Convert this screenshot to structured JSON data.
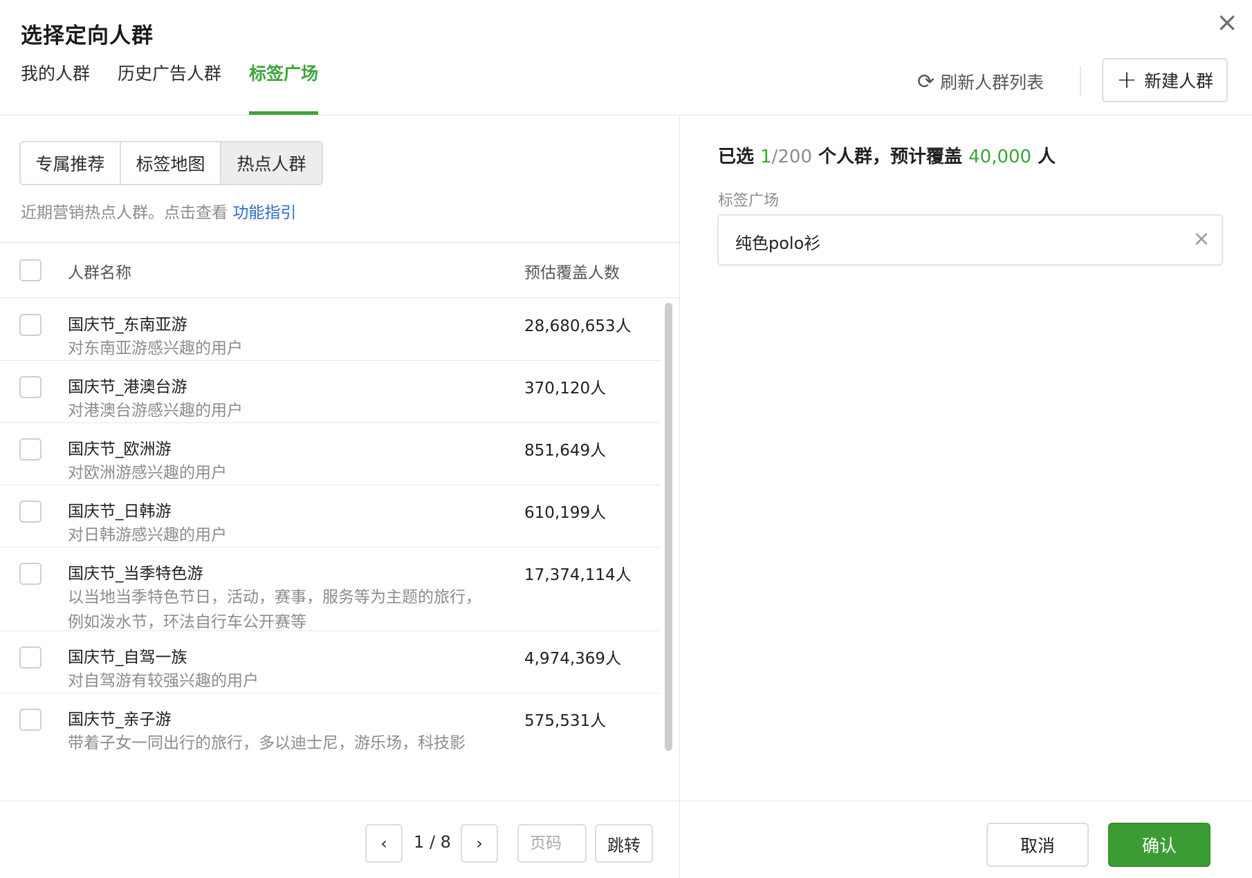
{
  "dialog": {
    "title": "选择定向人群",
    "close_icon": "×"
  },
  "tabs": [
    {
      "label": "我的人群",
      "active": false
    },
    {
      "label": "历史广告人群",
      "active": false
    },
    {
      "label": "标签广场",
      "active": true
    }
  ],
  "toolbar": {
    "refresh_icon": "⟳",
    "refresh_label": "刷新人群列表",
    "new_icon": "+",
    "new_label": "新建人群"
  },
  "segments": [
    {
      "label": "专属推荐",
      "active": false
    },
    {
      "label": "标签地图",
      "active": false
    },
    {
      "label": "热点人群",
      "active": true
    }
  ],
  "hint": {
    "text": "近期营销热点人群。点击查看 ",
    "link": "功能指引"
  },
  "table": {
    "header_name": "人群名称",
    "header_count": "预估覆盖人数",
    "rows": [
      {
        "name": "国庆节_东南亚游",
        "desc": "对东南亚游感兴趣的用户",
        "count": "28,680,653人"
      },
      {
        "name": "国庆节_港澳台游",
        "desc": "对港澳台游感兴趣的用户",
        "count": "370,120人"
      },
      {
        "name": "国庆节_欧洲游",
        "desc": "对欧洲游感兴趣的用户",
        "count": "851,649人"
      },
      {
        "name": "国庆节_日韩游",
        "desc": "对日韩游感兴趣的用户",
        "count": "610,199人"
      },
      {
        "name": "国庆节_当季特色游",
        "desc": "以当地当季特色节日，活动，赛事，服务等为主题的旅行，例如泼水节，环法自行车公开赛等",
        "count": "17,374,114人"
      },
      {
        "name": "国庆节_自驾一族",
        "desc": "对自驾游有较强兴趣的用户",
        "count": "4,974,369人"
      },
      {
        "name": "国庆节_亲子游",
        "desc": "带着子女一同出行的旅行，多以迪士尼，游乐场，科技影",
        "count": "575,531人"
      }
    ]
  },
  "pagination": {
    "prev_icon": "‹",
    "next_icon": "›",
    "page_text": "1 / 8",
    "input_placeholder": "页码",
    "jump_label": "跳转"
  },
  "summary": {
    "prefix": "已选 ",
    "selected": "1",
    "limit": "/200",
    "middle": " 个人群，预计覆盖 ",
    "coverage": "40,000",
    "suffix": " 人"
  },
  "selected_section": {
    "label": "标签广场",
    "tag": "纯色polo衫",
    "remove_icon": "×"
  },
  "footer": {
    "cancel_label": "取消",
    "confirm_label": "确认"
  },
  "colors": {
    "accent": "#3aa53a",
    "link": "#2f6dc5",
    "confirm_bg": "#3c9c34"
  }
}
